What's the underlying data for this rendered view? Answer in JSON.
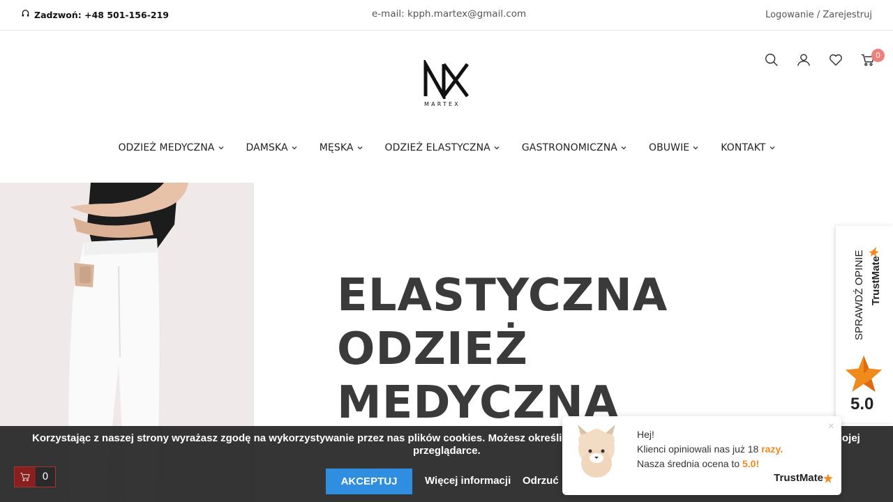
{
  "topbar": {
    "phone_label": "Zadzwoń: +48 501-156-219",
    "email": "e-mail: kpph.martex@gmail.com",
    "login": "Logowanie",
    "separator": "/",
    "register": "Zarejestruj"
  },
  "header": {
    "logo_text": "MARTEX",
    "cart_count": "0",
    "icons": [
      "search-icon",
      "user-icon",
      "heart-icon",
      "cart-icon"
    ]
  },
  "nav": {
    "items": [
      {
        "label": "ODZIEŻ MEDYCZNA"
      },
      {
        "label": "DAMSKA"
      },
      {
        "label": "MĘSKA"
      },
      {
        "label": "ODZIEŻ ELASTYCZNA"
      },
      {
        "label": "GASTRONOMICZNA"
      },
      {
        "label": "OBUWIE"
      },
      {
        "label": "KONTAKT"
      }
    ]
  },
  "hero": {
    "line1": "ELASTYCZNA",
    "line2": "ODZIEŻ",
    "line3": "MEDYCZNA"
  },
  "trustmate_side": {
    "label": "SPRAWDŹ OPINIE",
    "brand": "TrustMate",
    "score": "5.0"
  },
  "cookie": {
    "message_part1": "Korzystając z naszej strony wyrażasz zgodę na wykorzystywanie przez nas plików cookies. Możesz określić war",
    "message_part_right": "ojej",
    "message_line2": "przeglądarce.",
    "accept_label": "AKCEPTUJ",
    "more_label": "Więcej informacji",
    "decline_label": "Odrzuć"
  },
  "mini_cart": {
    "count": "0"
  },
  "trustmate_popup": {
    "greeting": "Hej!",
    "line1_prefix": "Klienci opiniowali nas już 18 ",
    "line1_highlight": "razy.",
    "line2_prefix": "Nasza średnia ocena to ",
    "line2_highlight": "5.0!",
    "brand": "TrustMate",
    "close": "×"
  },
  "colors": {
    "accent_badge": "#f07e79",
    "accept_button": "#2f8ee0",
    "highlight": "#f08a1c",
    "cookie_bg": "#2a2a2a"
  }
}
